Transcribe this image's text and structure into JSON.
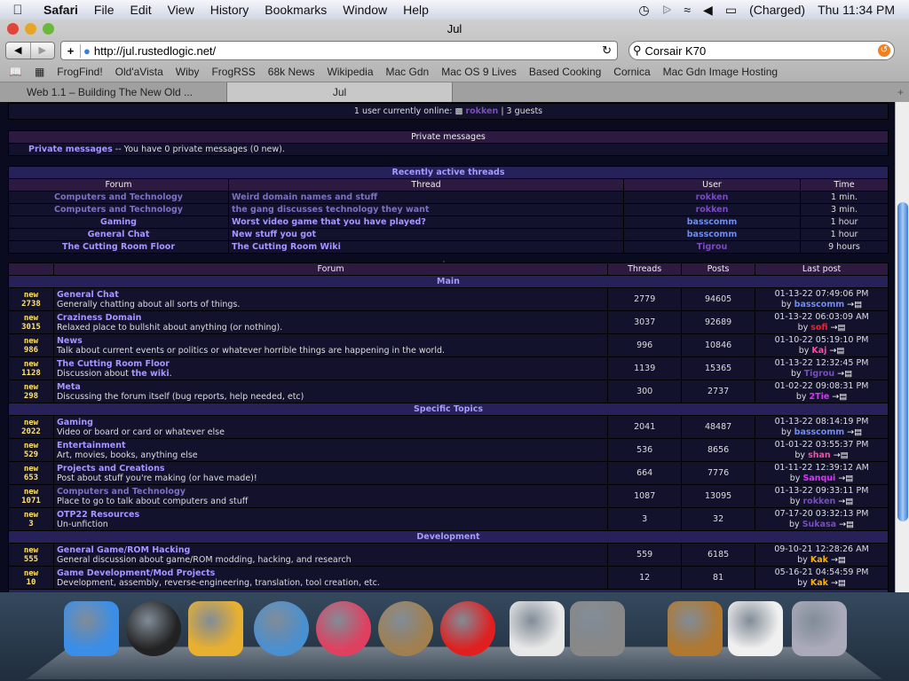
{
  "menubar": {
    "app": "Safari",
    "items": [
      "File",
      "Edit",
      "View",
      "History",
      "Bookmarks",
      "Window",
      "Help"
    ],
    "battery": "(Charged)",
    "clock": "Thu 11:34 PM"
  },
  "window": {
    "title": "Jul"
  },
  "toolbar": {
    "url": "http://jul.rustedlogic.net/",
    "search": "Corsair K70"
  },
  "bookmarks": [
    "FrogFind!",
    "Old'aVista",
    "Wiby",
    "FrogRSS",
    "68k News",
    "Wikipedia",
    "Mac Gdn",
    "Mac OS 9 Lives",
    "Based Cooking",
    "Cornica",
    "Mac Gdn Image Hosting"
  ],
  "tabs": [
    {
      "label": "Web 1.1 – Building The New Old ..."
    },
    {
      "label": "Jul",
      "active": true
    }
  ],
  "online": {
    "text": "1 user currently online:",
    "user": "rokken",
    "guests": "| 3 guests"
  },
  "pm": {
    "header": "Private messages",
    "link": "Private messages",
    "text": "-- You have 0 private messages (0 new)."
  },
  "recent": {
    "header": "Recently active threads",
    "columns": [
      "Forum",
      "Thread",
      "User",
      "Time"
    ],
    "rows": [
      {
        "forum": "Computers and Technology",
        "thread": "Weird domain names and stuff",
        "user": "rokken",
        "time": "1 min."
      },
      {
        "forum": "Computers and Technology",
        "thread": "the gang discusses technology they want",
        "user": "rokken",
        "time": "3 min."
      },
      {
        "forum": "Gaming",
        "thread": "Worst video game that you have played?",
        "user": "basscomm",
        "time": "1 hour"
      },
      {
        "forum": "General Chat",
        "thread": "New stuff you got",
        "user": "basscomm",
        "time": "1 hour"
      },
      {
        "forum": "The Cutting Room Floor",
        "thread": "The Cutting Room Wiki",
        "user": "Tigrou",
        "time": "9 hours"
      }
    ]
  },
  "forums": {
    "columns": [
      "",
      "Forum",
      "Threads",
      "Posts",
      "Last post"
    ],
    "sections": [
      {
        "name": "Main",
        "forums": [
          {
            "new": "new",
            "count": "2738",
            "name": "General Chat",
            "desc": "Generally chatting about all sorts of things.",
            "threads": "2779",
            "posts": "94605",
            "date": "01-13-22 07:49:06 PM",
            "by": "by",
            "user": "basscomm",
            "ucolor": "#6f8cf0"
          },
          {
            "new": "new",
            "count": "3015",
            "name": "Craziness Domain",
            "desc": "Relaxed place to bullshit about anything (or nothing).",
            "threads": "3037",
            "posts": "92689",
            "date": "01-13-22 06:03:09 AM",
            "by": "by",
            "user": "sofi",
            "ucolor": "#ff1a2a"
          },
          {
            "new": "new",
            "count": "986",
            "name": "News",
            "desc": "Talk about current events or politics or whatever horrible things are happening in the world.",
            "threads": "996",
            "posts": "10846",
            "date": "01-10-22 05:19:10 PM",
            "by": "by",
            "user": "Kaj",
            "ucolor": "#ff4aa0"
          },
          {
            "new": "new",
            "count": "1128",
            "name": "The Cutting Room Floor",
            "desc": "Discussion about ",
            "desc_link": "the wiki",
            "desc_end": ".",
            "threads": "1139",
            "posts": "15365",
            "date": "01-13-22 12:32:45 PM",
            "by": "by",
            "user": "Tigrou",
            "ucolor": "#7a4ac0"
          },
          {
            "new": "new",
            "count": "298",
            "name": "Meta",
            "desc": "Discussing the forum itself (bug reports, help needed, etc)",
            "threads": "300",
            "posts": "2737",
            "date": "01-02-22 09:08:31 PM",
            "by": "by",
            "user": "2Tie",
            "ucolor": "#e030ff"
          }
        ]
      },
      {
        "name": "Specific Topics",
        "forums": [
          {
            "new": "new",
            "count": "2022",
            "name": "Gaming",
            "desc": "Video or board or card or whatever else",
            "threads": "2041",
            "posts": "48487",
            "date": "01-13-22 08:14:19 PM",
            "by": "by",
            "user": "basscomm",
            "ucolor": "#6f8cf0"
          },
          {
            "new": "new",
            "count": "529",
            "name": "Entertainment",
            "desc": "Art, movies, books, anything else",
            "threads": "536",
            "posts": "8656",
            "date": "01-01-22 03:55:37 PM",
            "by": "by",
            "user": "shan",
            "ucolor": "#ff4aa0"
          },
          {
            "new": "new",
            "count": "653",
            "name": "Projects and Creations",
            "desc": "Post about stuff you're making (or have made)!",
            "threads": "664",
            "posts": "7776",
            "date": "01-11-22 12:39:12 AM",
            "by": "by",
            "user": "Sanqui",
            "ucolor": "#e030ff"
          },
          {
            "new": "new",
            "count": "1071",
            "name": "Computers and Technology",
            "desc": "Place to go to talk about computers and stuff",
            "threads": "1087",
            "posts": "13095",
            "date": "01-13-22 09:33:11 PM",
            "by": "by",
            "user": "rokken",
            "ucolor": "#7a4ac0",
            "dim": true
          },
          {
            "new": "new",
            "count": "3",
            "name": "OTP22 Resources",
            "desc": "Un-unfiction",
            "threads": "3",
            "posts": "32",
            "date": "07-17-20 03:32:13 PM",
            "by": "by",
            "user": "Sukasa",
            "ucolor": "#7a4ac0"
          }
        ]
      },
      {
        "name": "Development",
        "forums": [
          {
            "new": "new",
            "count": "555",
            "name": "General Game/ROM Hacking",
            "desc": "General discussion about game/ROM modding, hacking, and research",
            "threads": "559",
            "posts": "6185",
            "date": "09-10-21 12:28:26 AM",
            "by": "by",
            "user": "Kak",
            "ucolor": "#ffb000"
          },
          {
            "new": "new",
            "count": "10",
            "name": "Game Development/Mod Projects",
            "desc": "Development, assembly, reverse-engineering, translation, tool creation, etc.",
            "threads": "12",
            "posts": "81",
            "date": "05-16-21 04:54:59 PM",
            "by": "by",
            "user": "Kak",
            "ucolor": "#ffb000"
          }
        ]
      }
    ]
  },
  "dock": [
    {
      "name": "finder",
      "color": "#3a8ee8"
    },
    {
      "name": "dashboard",
      "color": "#222"
    },
    {
      "name": "safari",
      "color": "#e8b030"
    },
    {
      "name": "network-globe",
      "color": "#4a90d0"
    },
    {
      "name": "discord",
      "color": "#e04060"
    },
    {
      "name": "gimp",
      "color": "#a08050"
    },
    {
      "name": "youtube",
      "color": "#e02020"
    },
    {
      "name": "document",
      "color": "#e8e8e8"
    },
    {
      "name": "system-preferences",
      "color": "#888"
    },
    {
      "name": "address-book",
      "color": "#b07830"
    },
    {
      "name": "preview",
      "color": "#f0f0f0"
    },
    {
      "name": "trash",
      "color": "#aab"
    }
  ]
}
